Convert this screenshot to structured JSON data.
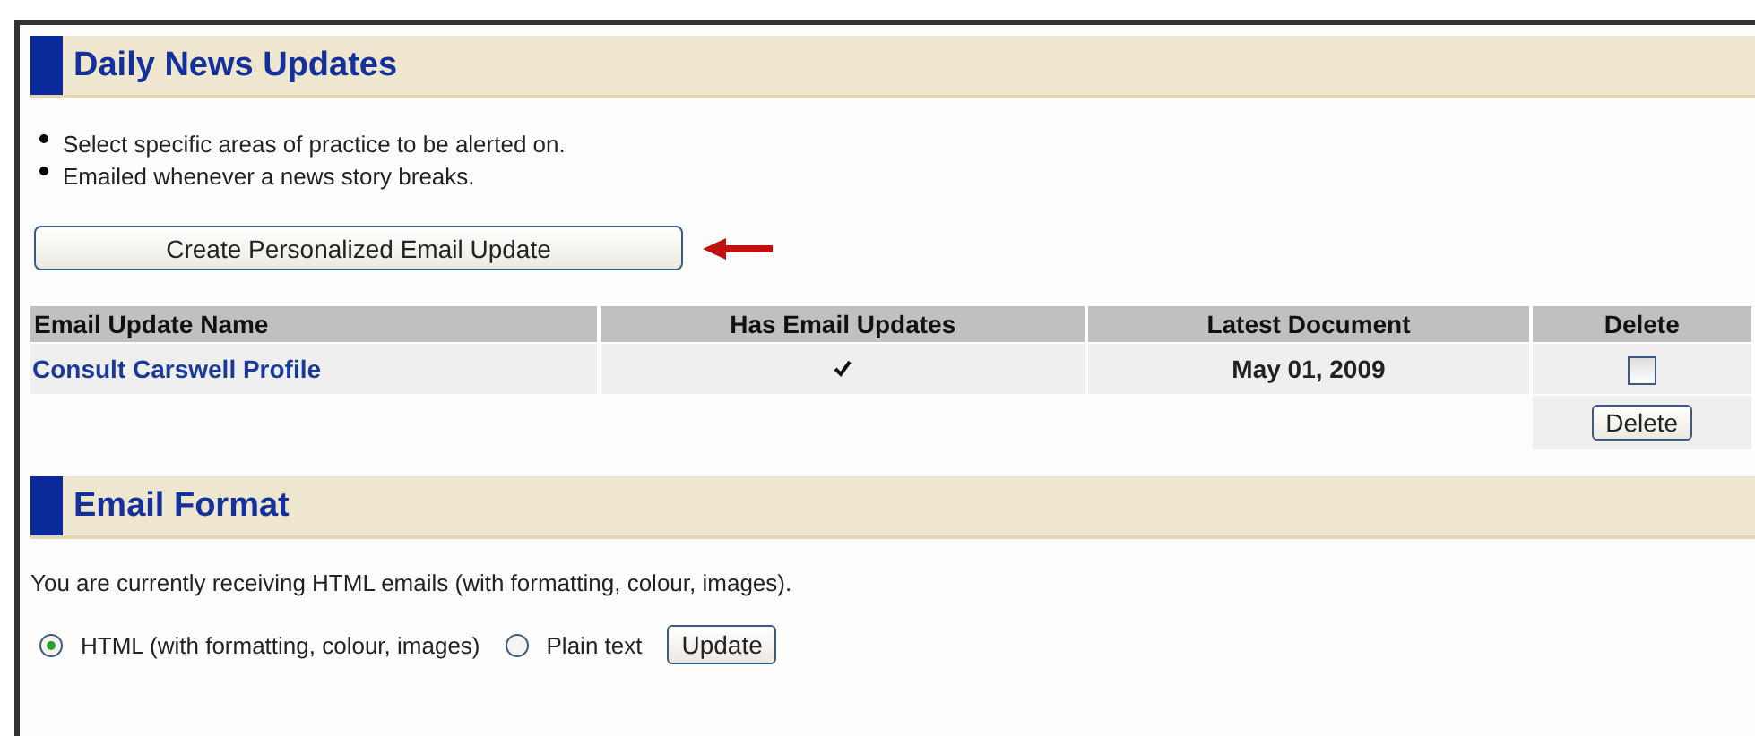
{
  "daily_news": {
    "title": "Daily News Updates",
    "bullets": [
      "Select specific areas of practice to be alerted on.",
      "Emailed whenever a news story breaks."
    ],
    "create_button": "Create Personalized Email Update",
    "table": {
      "columns": [
        "Email Update Name",
        "Has Email Updates",
        "Latest Document",
        "Delete"
      ],
      "rows": [
        {
          "name": "Consult Carswell Profile",
          "has_email_updates": true,
          "latest_document": "May 01, 2009",
          "delete_checked": false
        }
      ],
      "delete_button": "Delete"
    }
  },
  "email_format": {
    "title": "Email Format",
    "message": "You are currently receiving HTML emails (with formatting, colour, images).",
    "options": [
      {
        "label": "HTML (with formatting, colour, images)",
        "selected": true
      },
      {
        "label": "Plain text",
        "selected": false
      }
    ],
    "update_button": "Update"
  }
}
